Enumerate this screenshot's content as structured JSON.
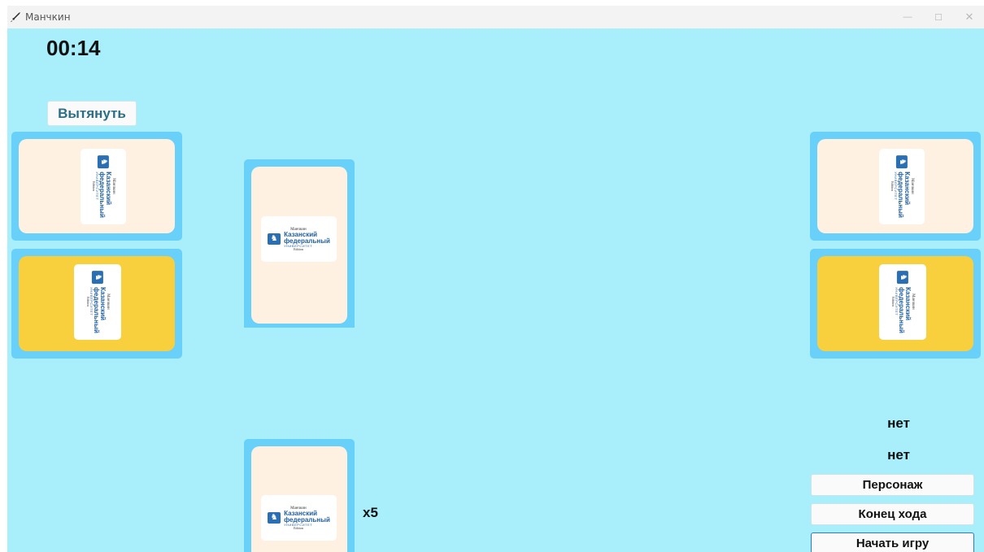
{
  "window": {
    "title": "Манчкин",
    "controls": {
      "minimize": "—",
      "maximize": "☐",
      "close": "✕"
    },
    "icon": "sword-icon"
  },
  "game": {
    "timer": "00:14",
    "draw_button": "Вытянуть",
    "hand_multiplier": "x5",
    "status_lines": [
      "нет",
      "нет"
    ],
    "buttons": {
      "character": "Персонаж",
      "end_turn": "Конец хода",
      "start_game": "Начать игру"
    },
    "card_back_logo": {
      "line1": "Манчкин",
      "line2": "Казанский",
      "line3": "федеральный",
      "line4": "УНИВЕРСИТЕТ",
      "line5": "Edition"
    },
    "colors": {
      "background": "#a8eefb",
      "slot": "#69d1f9",
      "door_card": "#fef1e1",
      "treasure_card": "#f8d03e"
    }
  }
}
